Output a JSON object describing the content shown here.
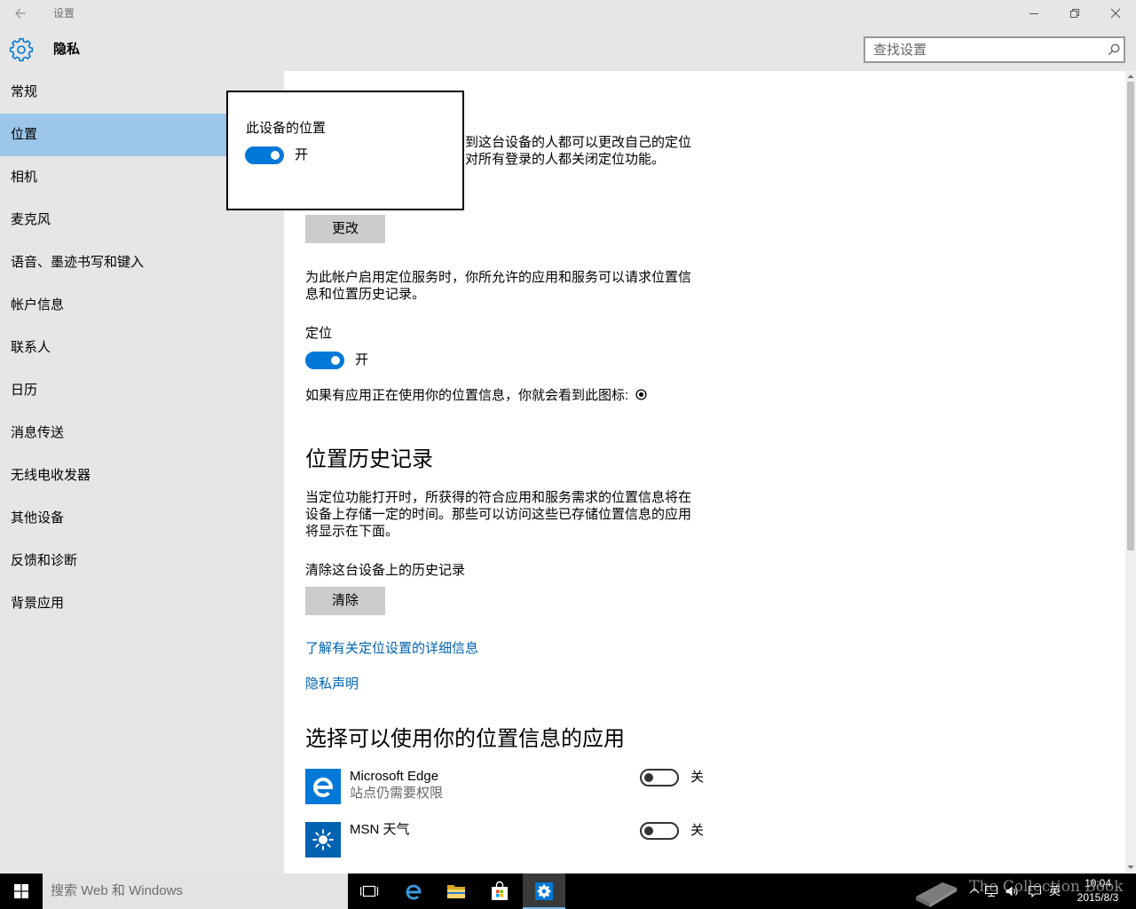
{
  "window": {
    "title": "设置",
    "back_icon": "back-arrow-icon",
    "minimize_icon": "minimize-icon",
    "restore_icon": "restore-icon",
    "close_icon": "close-icon"
  },
  "header": {
    "icon": "gear-icon",
    "title": "隐私",
    "search": {
      "placeholder": "查找设置",
      "value": "",
      "icon": "search-icon"
    }
  },
  "sidebar": {
    "selected_index": 1,
    "items": [
      {
        "label": "常规"
      },
      {
        "label": "位置"
      },
      {
        "label": "相机"
      },
      {
        "label": "麦克风"
      },
      {
        "label": "语音、墨迹书写和键入"
      },
      {
        "label": "帐户信息"
      },
      {
        "label": "联系人"
      },
      {
        "label": "日历"
      },
      {
        "label": "消息传送"
      },
      {
        "label": "无线电收发器"
      },
      {
        "label": "其他设备"
      },
      {
        "label": "反馈和诊断"
      },
      {
        "label": "背景应用"
      }
    ]
  },
  "main": {
    "device_location_desc": [
      "到这台设备的人都可以更改自己的定位",
      "对所有登录的人都关闭定位功能。"
    ],
    "change_button": "更改",
    "account_desc": [
      "为此帐户启用定位服务时，你所允许的应用和服务可以请求位置信",
      "息和位置历史记录。"
    ],
    "location": {
      "label": "定位",
      "on": true,
      "state_label": "开"
    },
    "indicator_hint": "如果有应用正在使用你的位置信息，你就会看到此图标:",
    "indicator_icon": "location-in-use-icon",
    "history": {
      "heading": "位置历史记录",
      "desc": [
        "当定位功能打开时，所获得的符合应用和服务需求的位置信息将在",
        "设备上存储一定的时间。那些可以访问这些已存储位置信息的应用",
        "将显示在下面。"
      ],
      "clear_label": "清除这台设备上的历史记录",
      "clear_button": "清除"
    },
    "links": {
      "learn_more": "了解有关定位设置的详细信息",
      "privacy": "隐私声明"
    },
    "apps": {
      "heading": "选择可以使用你的位置信息的应用",
      "items": [
        {
          "name": "Microsoft Edge",
          "subtitle": "站点仍需要权限",
          "icon": "edge-icon",
          "on": false,
          "state_label": "关"
        },
        {
          "name": "MSN 天气",
          "icon": "weather-sun-icon",
          "on": false,
          "state_label": "关"
        }
      ]
    }
  },
  "popup": {
    "title": "此设备的位置",
    "on": true,
    "state_label": "开"
  },
  "taskbar": {
    "start_icon": "windows-logo-icon",
    "search_placeholder": "搜索 Web 和 Windows",
    "pinned": [
      "task-view-icon",
      "edge-icon",
      "file-explorer-icon",
      "store-icon",
      "settings-icon"
    ],
    "active_app": "settings-icon",
    "tray": {
      "icons": [
        "chevron-up-icon",
        "network-icon",
        "volume-icon",
        "action-center-icon"
      ],
      "input_indicator": "英",
      "time": "10:04",
      "date": "2015/8/3"
    }
  },
  "watermark": "The Collection Book",
  "colors": {
    "accent": "#0078d7",
    "sidebar_bg": "#e6e6e6",
    "sidebar_selected": "#9cc6ea",
    "link": "#0063b1",
    "button_bg": "#cccccc",
    "taskbar_bg": "#000000",
    "edge_tile": "#0078d7",
    "weather_tile": "#0063b1"
  }
}
